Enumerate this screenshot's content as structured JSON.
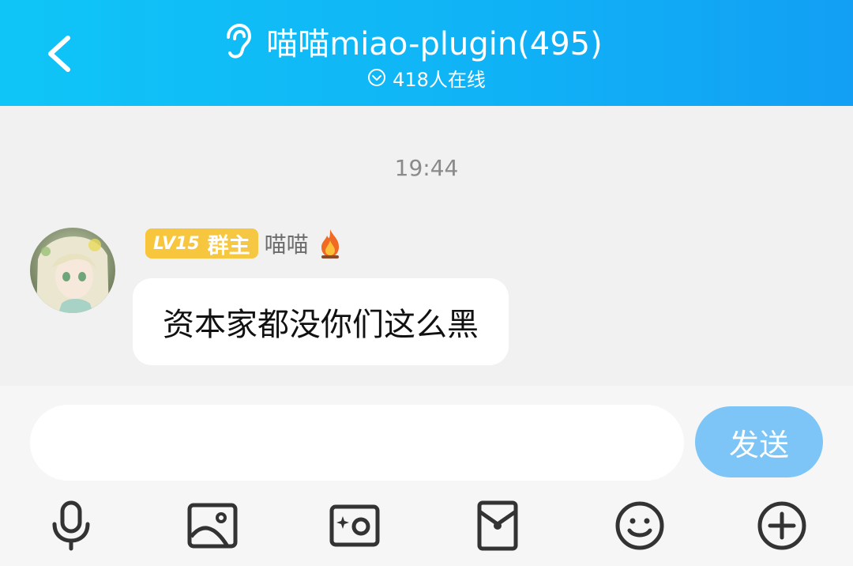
{
  "header": {
    "title": "喵喵miao-plugin(495)",
    "online_count": "418人在线",
    "icons": [
      "back-arrow-icon",
      "ear-icon",
      "check-circle-icon"
    ]
  },
  "chat": {
    "timestamp": "19:44",
    "messages": [
      {
        "badge_level": "LV15",
        "badge_role": "群主",
        "sender": "喵喵",
        "text": "资本家都没你们这么黑"
      }
    ]
  },
  "input": {
    "value": "",
    "placeholder": "",
    "send_label": "发送"
  },
  "toolbar": {
    "icons": [
      "microphone-icon",
      "image-icon",
      "camera-icon",
      "red-packet-icon",
      "emoji-icon",
      "plus-icon"
    ]
  },
  "colors": {
    "header_start": "#0fc5f7",
    "header_end": "#129ff4",
    "badge": "#f8c63b",
    "send_button": "#7cc5f6"
  }
}
